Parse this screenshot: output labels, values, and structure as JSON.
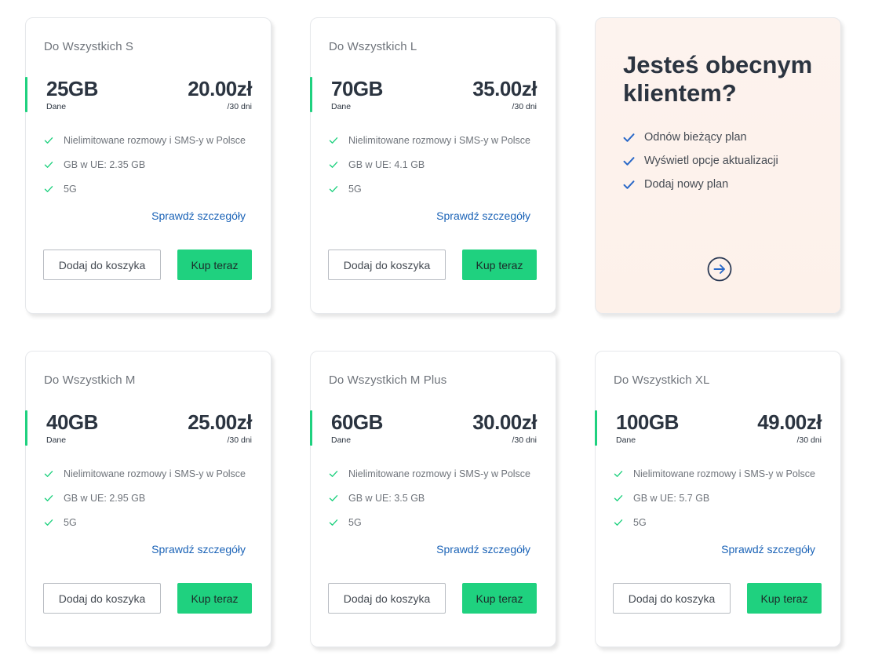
{
  "colors": {
    "accent_green": "#1fd17f",
    "link_blue": "#1b63b7",
    "check_blue": "#2a69c8",
    "text_dark": "#2b3440",
    "promo_bg": "#fdf3ee"
  },
  "plans": [
    {
      "name": "Do Wszystkich S",
      "data": "25GB",
      "data_label": "Dane",
      "price": "20.00zł",
      "period": "/30 dni",
      "features": [
        "Nielimitowane rozmowy i SMS-y w Polsce",
        "GB w UE: 2.35 GB",
        "5G"
      ],
      "details_link": "Sprawdź szczegóły",
      "add_to_cart": "Dodaj do koszyka",
      "buy_now": "Kup teraz"
    },
    {
      "name": "Do Wszystkich L",
      "data": "70GB",
      "data_label": "Dane",
      "price": "35.00zł",
      "period": "/30 dni",
      "features": [
        "Nielimitowane rozmowy i SMS-y w Polsce",
        "GB w UE: 4.1 GB",
        "5G"
      ],
      "details_link": "Sprawdź szczegóły",
      "add_to_cart": "Dodaj do koszyka",
      "buy_now": "Kup teraz"
    },
    {
      "name": "Do Wszystkich M",
      "data": "40GB",
      "data_label": "Dane",
      "price": "25.00zł",
      "period": "/30 dni",
      "features": [
        "Nielimitowane rozmowy i SMS-y w Polsce",
        "GB w UE: 2.95 GB",
        "5G"
      ],
      "details_link": "Sprawdź szczegóły",
      "add_to_cart": "Dodaj do koszyka",
      "buy_now": "Kup teraz"
    },
    {
      "name": "Do Wszystkich M Plus",
      "data": "60GB",
      "data_label": "Dane",
      "price": "30.00zł",
      "period": "/30 dni",
      "features": [
        "Nielimitowane rozmowy i SMS-y w Polsce",
        "GB w UE: 3.5 GB",
        "5G"
      ],
      "details_link": "Sprawdź szczegóły",
      "add_to_cart": "Dodaj do koszyka",
      "buy_now": "Kup teraz"
    },
    {
      "name": "Do Wszystkich XL",
      "data": "100GB",
      "data_label": "Dane",
      "price": "49.00zł",
      "period": "/30 dni",
      "features": [
        "Nielimitowane rozmowy i SMS-y w Polsce",
        "GB w UE: 5.7 GB",
        "5G"
      ],
      "details_link": "Sprawdź szczegóły",
      "add_to_cart": "Dodaj do koszyka",
      "buy_now": "Kup teraz"
    }
  ],
  "promo": {
    "title": "Jesteś obecnym klientem?",
    "items": [
      "Odnów bieżący plan",
      "Wyświetl opcje aktualizacji",
      "Dodaj nowy plan"
    ],
    "arrow_icon": "arrow-right-circle-icon"
  }
}
